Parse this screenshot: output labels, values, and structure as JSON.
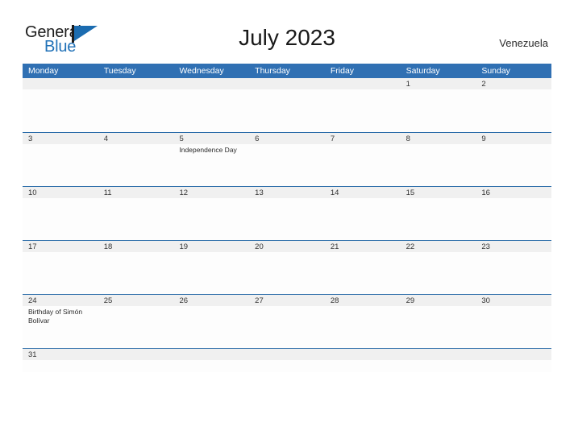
{
  "brand": {
    "line1": "General",
    "line2": "Blue",
    "flag_icon": "flag-triangle-icon",
    "accent_color": "#1b6cb0",
    "text_color": "#1c1c1c"
  },
  "header": {
    "title": "July 2023",
    "region": "Venezuela"
  },
  "theme": {
    "header_blue": "#3070b3",
    "row_border_blue": "#2a6ca9",
    "band_gray": "#f0f0f0",
    "cell_white": "#fdfdfd"
  },
  "calendar": {
    "weekdays": [
      "Monday",
      "Tuesday",
      "Wednesday",
      "Thursday",
      "Friday",
      "Saturday",
      "Sunday"
    ],
    "weeks": [
      [
        {
          "date": "",
          "event": ""
        },
        {
          "date": "",
          "event": ""
        },
        {
          "date": "",
          "event": ""
        },
        {
          "date": "",
          "event": ""
        },
        {
          "date": "",
          "event": ""
        },
        {
          "date": "1",
          "event": ""
        },
        {
          "date": "2",
          "event": ""
        }
      ],
      [
        {
          "date": "3",
          "event": ""
        },
        {
          "date": "4",
          "event": ""
        },
        {
          "date": "5",
          "event": "Independence Day"
        },
        {
          "date": "6",
          "event": ""
        },
        {
          "date": "7",
          "event": ""
        },
        {
          "date": "8",
          "event": ""
        },
        {
          "date": "9",
          "event": ""
        }
      ],
      [
        {
          "date": "10",
          "event": ""
        },
        {
          "date": "11",
          "event": ""
        },
        {
          "date": "12",
          "event": ""
        },
        {
          "date": "13",
          "event": ""
        },
        {
          "date": "14",
          "event": ""
        },
        {
          "date": "15",
          "event": ""
        },
        {
          "date": "16",
          "event": ""
        }
      ],
      [
        {
          "date": "17",
          "event": ""
        },
        {
          "date": "18",
          "event": ""
        },
        {
          "date": "19",
          "event": ""
        },
        {
          "date": "20",
          "event": ""
        },
        {
          "date": "21",
          "event": ""
        },
        {
          "date": "22",
          "event": ""
        },
        {
          "date": "23",
          "event": ""
        }
      ],
      [
        {
          "date": "24",
          "event": "Birthday of Simón Bolívar"
        },
        {
          "date": "25",
          "event": ""
        },
        {
          "date": "26",
          "event": ""
        },
        {
          "date": "27",
          "event": ""
        },
        {
          "date": "28",
          "event": ""
        },
        {
          "date": "29",
          "event": ""
        },
        {
          "date": "30",
          "event": ""
        }
      ],
      [
        {
          "date": "31",
          "event": ""
        },
        {
          "date": "",
          "event": ""
        },
        {
          "date": "",
          "event": ""
        },
        {
          "date": "",
          "event": ""
        },
        {
          "date": "",
          "event": ""
        },
        {
          "date": "",
          "event": ""
        },
        {
          "date": "",
          "event": ""
        }
      ]
    ]
  }
}
